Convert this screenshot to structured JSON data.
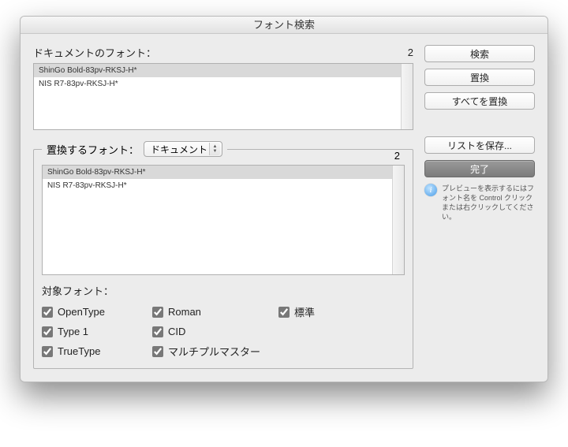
{
  "window": {
    "title": "フォント検索"
  },
  "doc_fonts": {
    "label": "ドキュメントのフォント：",
    "count": "2",
    "items": [
      "ShinGo Bold-83pv-RKSJ-H*",
      "NIS R7-83pv-RKSJ-H*"
    ]
  },
  "replace": {
    "label": "置換するフォント：",
    "select_value": "ドキュメント",
    "count": "2",
    "items": [
      "ShinGo Bold-83pv-RKSJ-H*",
      "NIS R7-83pv-RKSJ-H*"
    ]
  },
  "target": {
    "label": "対象フォント：",
    "checks": {
      "opentype": "OpenType",
      "roman": "Roman",
      "standard": "標準",
      "type1": "Type 1",
      "cid": "CID",
      "truetype": "TrueType",
      "multimaster": "マルチプルマスター"
    }
  },
  "buttons": {
    "find": "検索",
    "change": "置換",
    "change_all": "すべてを置換",
    "save_list": "リストを保存...",
    "done": "完了"
  },
  "info": {
    "text": "プレビューを表示するにはフォント名を Control クリックまたは右クリックしてください。"
  }
}
